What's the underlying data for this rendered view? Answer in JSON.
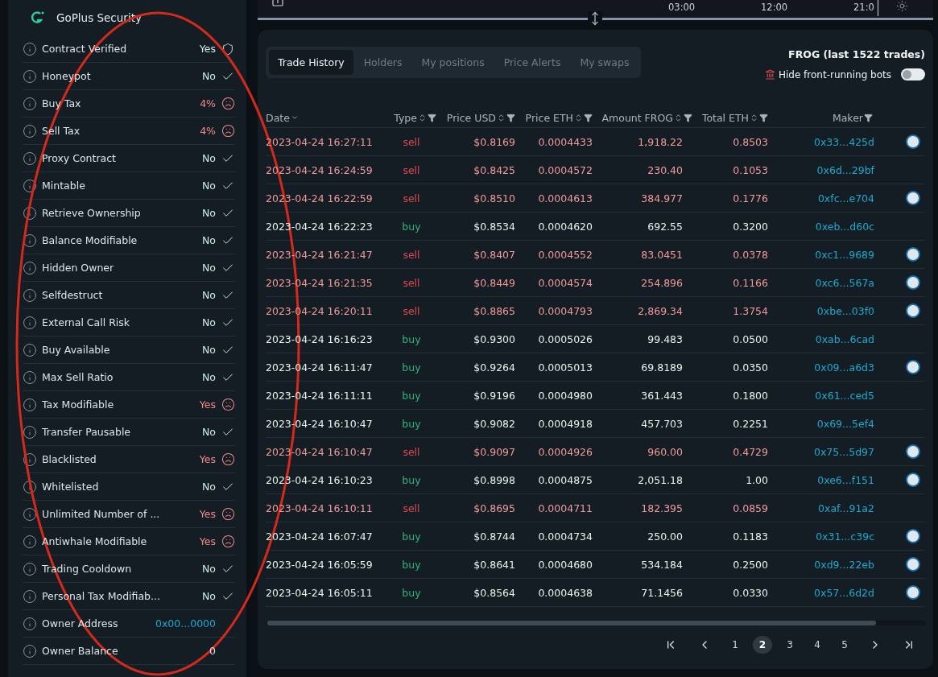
{
  "security": {
    "title": "GoPlus Security",
    "checks": [
      {
        "label": "Contract Verified",
        "value": "Yes",
        "kind": "shield"
      },
      {
        "label": "Honeypot",
        "value": "No",
        "kind": "ok"
      },
      {
        "label": "Buy Tax",
        "value": "4%",
        "kind": "bad"
      },
      {
        "label": "Sell Tax",
        "value": "4%",
        "kind": "bad"
      },
      {
        "label": "Proxy Contract",
        "value": "No",
        "kind": "ok"
      },
      {
        "label": "Mintable",
        "value": "No",
        "kind": "ok"
      },
      {
        "label": "Retrieve Ownership",
        "value": "No",
        "kind": "ok"
      },
      {
        "label": "Balance Modifiable",
        "value": "No",
        "kind": "ok"
      },
      {
        "label": "Hidden Owner",
        "value": "No",
        "kind": "ok"
      },
      {
        "label": "Selfdestruct",
        "value": "No",
        "kind": "ok"
      },
      {
        "label": "External Call Risk",
        "value": "No",
        "kind": "ok"
      },
      {
        "label": "Buy Available",
        "value": "No",
        "kind": "ok"
      },
      {
        "label": "Max Sell Ratio",
        "value": "No",
        "kind": "ok"
      },
      {
        "label": "Tax Modifiable",
        "value": "Yes",
        "kind": "bad"
      },
      {
        "label": "Transfer Pausable",
        "value": "No",
        "kind": "ok"
      },
      {
        "label": "Blacklisted",
        "value": "Yes",
        "kind": "bad"
      },
      {
        "label": "Whitelisted",
        "value": "No",
        "kind": "ok"
      },
      {
        "label": "Unlimited Number of ...",
        "value": "Yes",
        "kind": "bad"
      },
      {
        "label": "Antiwhale Modifiable",
        "value": "Yes",
        "kind": "bad"
      },
      {
        "label": "Trading Cooldown",
        "value": "No",
        "kind": "ok"
      },
      {
        "label": "Personal Tax Modifiab...",
        "value": "No",
        "kind": "ok"
      },
      {
        "label": "Owner Address",
        "value": "0x00...0000",
        "kind": "address"
      },
      {
        "label": "Owner Balance",
        "value": "0",
        "kind": "plain"
      }
    ]
  },
  "chart_strip": {
    "times": [
      "03:00",
      "12:00",
      "21:0"
    ]
  },
  "trades": {
    "tabs": [
      {
        "label": "Trade History",
        "selected": true
      },
      {
        "label": "Holders",
        "selected": false
      },
      {
        "label": "My positions",
        "selected": false
      },
      {
        "label": "Price Alerts",
        "selected": false
      },
      {
        "label": "My swaps",
        "selected": false
      }
    ],
    "summary": "FROG (last 1522 trades)",
    "hide_bots": {
      "label": "Hide front-running bots",
      "on": false
    },
    "columns": [
      "Date",
      "Type",
      "Price USD",
      "Price ETH",
      "Amount FROG",
      "Total ETH",
      "Maker"
    ],
    "rows": [
      {
        "date": "2023-04-24 16:27:11",
        "type": "sell",
        "kind": "sell",
        "usd": "$0.8169",
        "eth": "0.0004433",
        "amount": "1,918.22",
        "total": "0.8503",
        "maker": "0x33...425d",
        "maker_icon": true
      },
      {
        "date": "2023-04-24 16:24:59",
        "type": "sell",
        "kind": "sell",
        "usd": "$0.8425",
        "eth": "0.0004572",
        "amount": "230.40",
        "total": "0.1053",
        "maker": "0x6d...29bf",
        "maker_icon": false
      },
      {
        "date": "2023-04-24 16:22:59",
        "type": "sell",
        "kind": "sell",
        "usd": "$0.8510",
        "eth": "0.0004613",
        "amount": "384.977",
        "total": "0.1776",
        "maker": "0xfc...e704",
        "maker_icon": true
      },
      {
        "date": "2023-04-24 16:22:23",
        "type": "buy",
        "kind": "buy",
        "usd": "$0.8534",
        "eth": "0.0004620",
        "amount": "692.55",
        "total": "0.3200",
        "maker": "0xeb...d60c",
        "maker_icon": false
      },
      {
        "date": "2023-04-24 16:21:47",
        "type": "sell",
        "kind": "sell",
        "usd": "$0.8407",
        "eth": "0.0004552",
        "amount": "83.0451",
        "total": "0.0378",
        "maker": "0xc1...9689",
        "maker_icon": true
      },
      {
        "date": "2023-04-24 16:21:35",
        "type": "sell",
        "kind": "sell",
        "usd": "$0.8449",
        "eth": "0.0004574",
        "amount": "254.896",
        "total": "0.1166",
        "maker": "0xc6...567a",
        "maker_icon": true
      },
      {
        "date": "2023-04-24 16:20:11",
        "type": "sell",
        "kind": "sell",
        "usd": "$0.8865",
        "eth": "0.0004793",
        "amount": "2,869.34",
        "total": "1.3754",
        "maker": "0xbe...03f0",
        "maker_icon": true
      },
      {
        "date": "2023-04-24 16:16:23",
        "type": "buy",
        "kind": "buy",
        "usd": "$0.9300",
        "eth": "0.0005026",
        "amount": "99.483",
        "total": "0.0500",
        "maker": "0xab...6cad",
        "maker_icon": false
      },
      {
        "date": "2023-04-24 16:11:47",
        "type": "buy",
        "kind": "buy",
        "usd": "$0.9264",
        "eth": "0.0005013",
        "amount": "69.8189",
        "total": "0.0350",
        "maker": "0x09...a6d3",
        "maker_icon": true
      },
      {
        "date": "2023-04-24 16:11:11",
        "type": "buy",
        "kind": "buy",
        "usd": "$0.9196",
        "eth": "0.0004980",
        "amount": "361.443",
        "total": "0.1800",
        "maker": "0x61...ced5",
        "maker_icon": false
      },
      {
        "date": "2023-04-24 16:10:47",
        "type": "buy",
        "kind": "buy",
        "usd": "$0.9082",
        "eth": "0.0004918",
        "amount": "457.703",
        "total": "0.2251",
        "maker": "0x69...5ef4",
        "maker_icon": false
      },
      {
        "date": "2023-04-24 16:10:47",
        "type": "sell",
        "kind": "sell",
        "usd": "$0.9097",
        "eth": "0.0004926",
        "amount": "960.00",
        "total": "0.4729",
        "maker": "0x75...5d97",
        "maker_icon": true
      },
      {
        "date": "2023-04-24 16:10:23",
        "type": "buy",
        "kind": "buy",
        "usd": "$0.8998",
        "eth": "0.0004875",
        "amount": "2,051.18",
        "total": "1.00",
        "maker": "0xe6...f151",
        "maker_icon": true
      },
      {
        "date": "2023-04-24 16:10:11",
        "type": "sell",
        "kind": "sell",
        "usd": "$0.8695",
        "eth": "0.0004711",
        "amount": "182.395",
        "total": "0.0859",
        "maker": "0xaf...91a2",
        "maker_icon": false
      },
      {
        "date": "2023-04-24 16:07:47",
        "type": "buy",
        "kind": "buy",
        "usd": "$0.8744",
        "eth": "0.0004734",
        "amount": "250.00",
        "total": "0.1183",
        "maker": "0x31...c39c",
        "maker_icon": true
      },
      {
        "date": "2023-04-24 16:05:59",
        "type": "buy",
        "kind": "buy",
        "usd": "$0.8641",
        "eth": "0.0004680",
        "amount": "534.184",
        "total": "0.2500",
        "maker": "0xd9...22eb",
        "maker_icon": true
      },
      {
        "date": "2023-04-24 16:05:11",
        "type": "buy",
        "kind": "buy",
        "usd": "$0.8564",
        "eth": "0.0004638",
        "amount": "71.1456",
        "total": "0.0330",
        "maker": "0x57...6d2d",
        "maker_icon": true
      }
    ],
    "pages": [
      {
        "label": "1",
        "selected": false
      },
      {
        "label": "2",
        "selected": true
      },
      {
        "label": "3",
        "selected": false
      },
      {
        "label": "4",
        "selected": false
      },
      {
        "label": "5",
        "selected": false
      }
    ]
  }
}
